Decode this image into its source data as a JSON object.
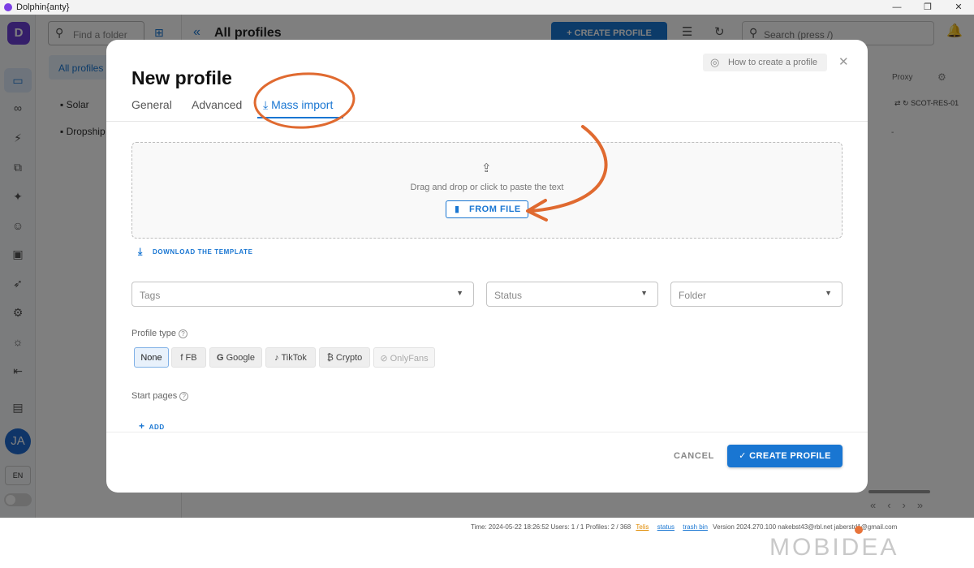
{
  "window": {
    "title": "Dolphin{anty}",
    "controls": [
      "—",
      "❐",
      "✕"
    ]
  },
  "rail": {
    "brand": "D",
    "avatar": "JA",
    "lang": "EN"
  },
  "folders": {
    "search_placeholder": "Find a folder",
    "all_label": "All profiles",
    "items": [
      "Solar",
      "Dropship"
    ]
  },
  "main": {
    "title": "All profiles",
    "create_label": "CREATE PROFILE",
    "search_placeholder": "Search (press /)",
    "col_proxy": "Proxy",
    "proxy_value": "SCOT-RES-01",
    "dash": "-"
  },
  "statusbar": {
    "time": "Time: 2024-05-22 18:26:52",
    "users": "Users: 1 / 1",
    "profiles": "Profiles: 2 / 368",
    "link1": "Telis",
    "link2": "status",
    "link3": "trash bin",
    "version": "Version 2024.270.100",
    "email1": "nakebst43@rbl.net",
    "email2": "jaberstd1@gmail.com"
  },
  "modal": {
    "title": "New profile",
    "howto": "How to create a profile",
    "tabs": {
      "general": "General",
      "advanced": "Advanced",
      "mass": "Mass import"
    },
    "drop_hint": "Drag and drop or click to paste the text",
    "from_file": "FROM FILE",
    "download_template": "DOWNLOAD THE TEMPLATE",
    "tags_placeholder": "Tags",
    "status_placeholder": "Status",
    "folder_placeholder": "Folder",
    "profile_type_label": "Profile type",
    "profile_types": {
      "none": "None",
      "fb": "FB",
      "google": "Google",
      "tiktok": "TikTok",
      "crypto": "Crypto",
      "onlyfans": "OnlyFans"
    },
    "start_pages_label": "Start pages",
    "add": "ADD",
    "cancel": "CANCEL",
    "create": "CREATE PROFILE"
  },
  "colors": {
    "primary": "#1976d2",
    "annotation": "#e06a30",
    "brand": "#6b3fd4"
  },
  "watermark": "MOBIDEA"
}
